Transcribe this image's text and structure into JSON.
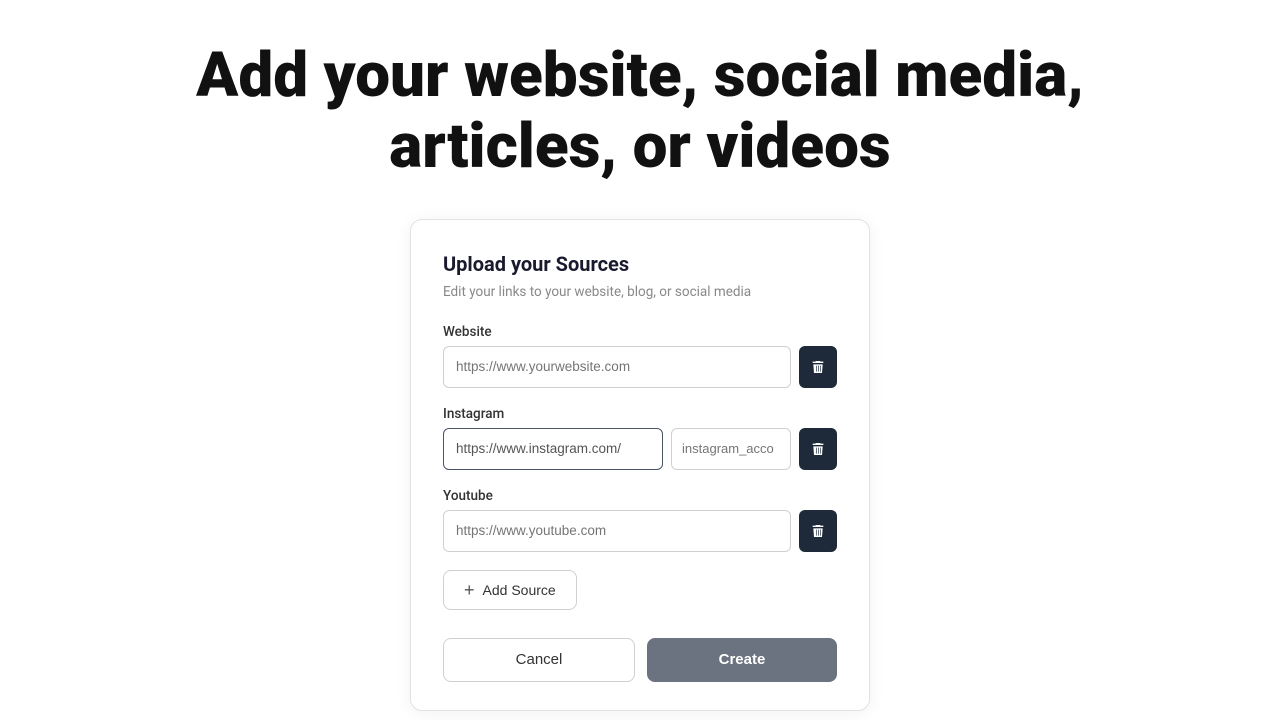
{
  "heading": {
    "line1": "Add your website, social media,",
    "line2": "articles, or videos",
    "full": "Add your website, social media, articles, or videos"
  },
  "card": {
    "title": "Upload your Sources",
    "subtitle": "Edit your links to your website, blog, or social media"
  },
  "fields": [
    {
      "id": "website",
      "label": "Website",
      "placeholder": "https://www.yourwebsite.com",
      "value": "",
      "has_secondary": false,
      "secondary_placeholder": ""
    },
    {
      "id": "instagram",
      "label": "Instagram",
      "placeholder": "https://www.instagram.com/",
      "value": "https://www.instagram.com/",
      "has_secondary": true,
      "secondary_placeholder": "instagram_acco"
    },
    {
      "id": "youtube",
      "label": "Youtube",
      "placeholder": "https://www.youtube.com",
      "value": "",
      "has_secondary": false,
      "secondary_placeholder": ""
    }
  ],
  "buttons": {
    "add_source": "Add Source",
    "cancel": "Cancel",
    "create": "Create"
  },
  "icons": {
    "trash": "trash-icon",
    "plus": "plus-icon"
  },
  "colors": {
    "delete_btn_bg": "#1e2a3a",
    "create_btn_bg": "#6b7280"
  }
}
